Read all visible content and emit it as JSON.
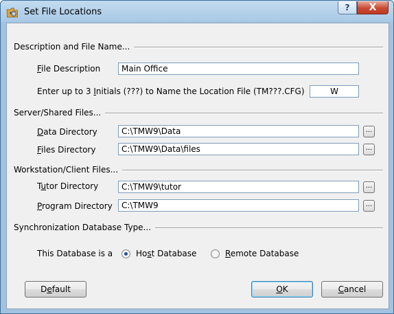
{
  "window": {
    "title": "Set File Locations",
    "help_glyph": "?",
    "close_glyph": "X"
  },
  "description_section": {
    "heading": "Description and File Name...",
    "file_description": {
      "label_hotkey": "F",
      "label_rest": "ile Description",
      "value": "Main Office"
    },
    "initials": {
      "label_prefix": "Enter up to 3 ",
      "label_hotkey": "I",
      "label_rest": "nitials (???) to Name the Location File (TM???.CFG)",
      "value": "W"
    }
  },
  "server_section": {
    "heading": "Server/Shared Files...",
    "data_directory": {
      "label_hotkey": "D",
      "label_rest": "ata Directory",
      "value": "C:\\TMW9\\Data"
    },
    "files_directory": {
      "label_hotkey": "F",
      "label_rest": "iles Directory",
      "value": "C:\\TMW9\\Data\\files"
    }
  },
  "workstation_section": {
    "heading": "Workstation/Client Files...",
    "tutor_directory": {
      "label_pre": "T",
      "label_hotkey": "u",
      "label_rest": "tor Directory",
      "value": "C:\\TMW9\\tutor"
    },
    "program_directory": {
      "label_hotkey": "P",
      "label_rest": "rogram Directory",
      "value": "C:\\TMW9"
    }
  },
  "sync_section": {
    "heading": "Synchronization Database Type...",
    "prompt": "This Database is a",
    "host": {
      "label_pre": "Ho",
      "label_hotkey": "s",
      "label_rest": "t Database",
      "selected": true
    },
    "remote": {
      "label_hotkey": "R",
      "label_rest": "emote Database",
      "selected": false
    }
  },
  "browse_glyph": "...",
  "buttons": {
    "default": {
      "label_pre": "D",
      "label_hotkey": "e",
      "label_rest": "fault"
    },
    "ok": {
      "label_hotkey": "O",
      "label_rest": "K"
    },
    "cancel": {
      "label_hotkey": "C",
      "label_rest": "ancel"
    }
  },
  "icons": {
    "app": "folder-with-gear-icon"
  }
}
